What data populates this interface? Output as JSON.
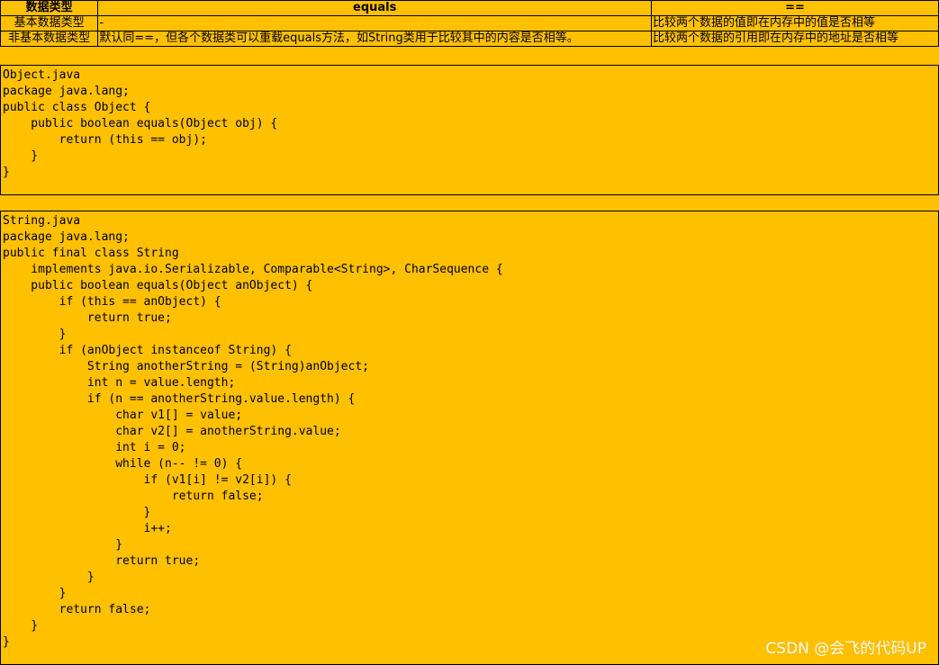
{
  "table": {
    "headers": [
      "数据类型",
      "equals",
      "=="
    ],
    "rows": [
      {
        "type": "基本数据类型",
        "equals": "-",
        "eq_op": "比较两个数据的值即在内存中的值是否相等"
      },
      {
        "type": "非基本数据类型",
        "equals": "默认同==，但各个数据类可以重载equals方法，如String类用于比较其中的内容是否相等。",
        "eq_op": "比较两个数据的引用即在内存中的地址是否相等"
      }
    ]
  },
  "object_code": "Object.java\npackage java.lang;\npublic class Object {\n    public boolean equals(Object obj) {\n        return (this == obj);\n    }\n}",
  "string_code": "String.java\npackage java.lang;\npublic final class String\n    implements java.io.Serializable, Comparable<String>, CharSequence {\n    public boolean equals(Object anObject) {\n        if (this == anObject) {\n            return true;\n        }\n        if (anObject instanceof String) {\n            String anotherString = (String)anObject;\n            int n = value.length;\n            if (n == anotherString.value.length) {\n                char v1[] = value;\n                char v2[] = anotherString.value;\n                int i = 0;\n                while (n-- != 0) {\n                    if (v1[i] != v2[i]) {\n                        return false;\n                    }\n                    i++;\n                }\n                return true;\n            }\n        }\n        return false;\n    }\n}",
  "watermark": "CSDN @会飞的代码UP",
  "colors": {
    "background": "#FFC000",
    "border": "#000000",
    "text": "#000000"
  }
}
